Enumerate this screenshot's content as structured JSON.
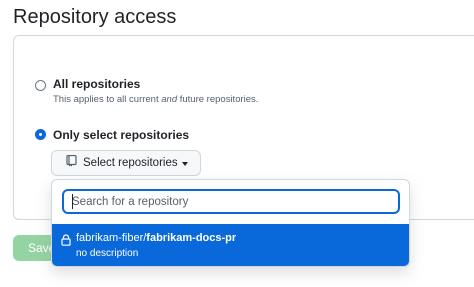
{
  "page": {
    "title": "Repository access"
  },
  "options": {
    "all": {
      "label": "All repositories",
      "description_before": "This applies to all current ",
      "description_emph": "and",
      "description_after": " future repositories.",
      "selected": false
    },
    "select": {
      "label": "Only select repositories",
      "selected": true
    }
  },
  "select_button": {
    "label": "Select repositories",
    "icon": "repo-icon"
  },
  "dropdown": {
    "search_placeholder": "Search for a repository",
    "search_value": "",
    "results": [
      {
        "owner": "fabrikam-fiber/",
        "name": "fabrikam-docs-pr",
        "description": "no description",
        "icon": "lock-icon",
        "highlighted": true
      }
    ]
  },
  "save_button": {
    "label": "Save"
  },
  "colors": {
    "accent": "#0969da",
    "save_disabled": "#94d3a2",
    "border": "#d0d7de"
  }
}
